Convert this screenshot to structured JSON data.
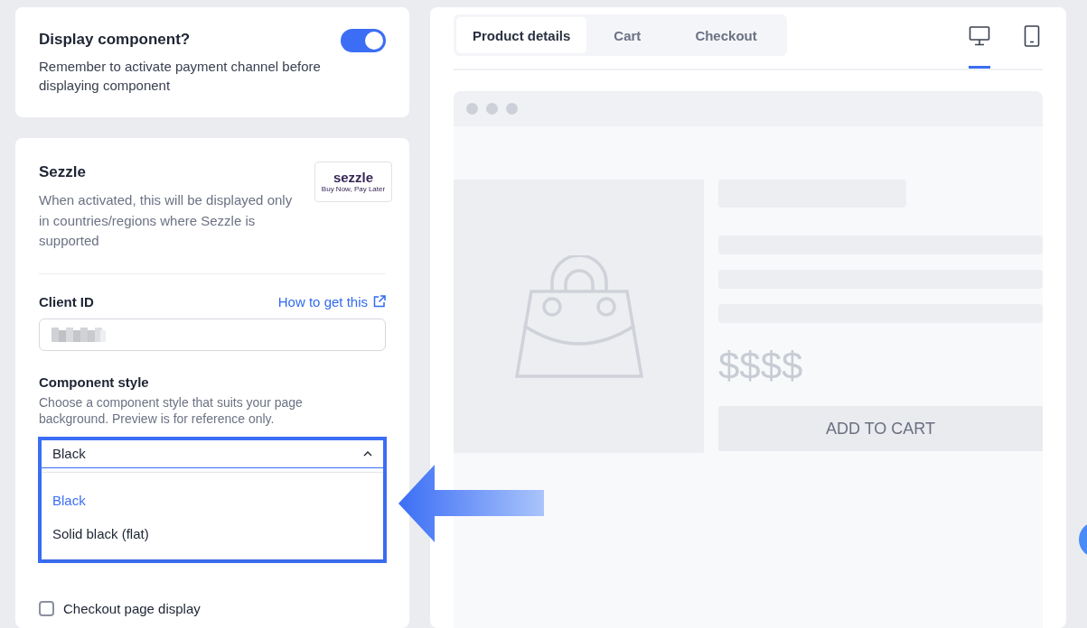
{
  "display_card": {
    "title": "Display component?",
    "description": "Remember to activate payment channel before displaying component",
    "toggle": {
      "on": true
    }
  },
  "sezzle_card": {
    "title": "Sezzle",
    "description": "When activated, this will be displayed only in countries/regions where Sezzle is supported",
    "logo": {
      "wordmark": "sezzle",
      "tagline": "Buy Now, Pay Later"
    },
    "client_id": {
      "label": "Client ID",
      "link": "How to get this"
    },
    "component_style": {
      "label": "Component style",
      "description": "Choose a component style that suits your page background. Preview is for reference only.",
      "value": "Black",
      "expanded": true,
      "options": [
        {
          "label": "Black",
          "selected": true
        },
        {
          "label": "Solid black (flat)",
          "selected": false
        }
      ]
    },
    "checkboxes": [
      {
        "label": "Checkout page display",
        "checked": false
      }
    ]
  },
  "preview": {
    "tabs": [
      {
        "label": "Product details",
        "selected": true
      },
      {
        "label": "Cart",
        "selected": false
      },
      {
        "label": "Checkout",
        "selected": false
      }
    ],
    "devices": [
      {
        "kind": "desktop",
        "selected": true
      },
      {
        "kind": "tablet",
        "selected": false
      }
    ],
    "product": {
      "price": "$$$$",
      "button": "ADD TO CART"
    }
  }
}
